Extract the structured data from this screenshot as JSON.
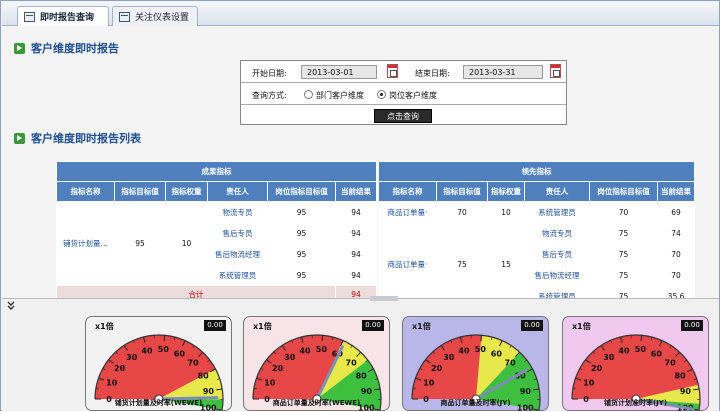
{
  "tabs": [
    {
      "label": "即时报告查询"
    },
    {
      "label": "关注仪表设置"
    }
  ],
  "section1": {
    "title": "客户维度即时报告"
  },
  "query": {
    "start_label": "开始日期:",
    "start_value": "2013-03-01",
    "end_label": "结束日期:",
    "end_value": "2013-03-31",
    "mode_label": "查询方式:",
    "options": [
      {
        "label": "部门客户维度",
        "selected": false
      },
      {
        "label": "岗位客户维度",
        "selected": true
      }
    ],
    "submit_label": "点击查询"
  },
  "section2": {
    "title": "客户维度即时报告列表"
  },
  "results": {
    "group_left": "成果指标",
    "group_right": "领先指标",
    "headers": [
      "指标名称",
      "指标目标值",
      "指标权重",
      "责任人",
      "岗位指标目标值",
      "当前结果"
    ],
    "left": {
      "name": "铺货计划量…",
      "target": "95",
      "weight": "10",
      "rows": [
        {
          "person": "物流专员",
          "target": "95",
          "result": "94"
        },
        {
          "person": "售后专员",
          "target": "95",
          "result": "94"
        },
        {
          "person": "售后物流经理",
          "target": "95",
          "result": "94"
        },
        {
          "person": "系统管理员",
          "target": "95",
          "result": "94"
        }
      ],
      "sum_label": "合计",
      "sum_value": "94"
    },
    "right": [
      {
        "name": "商品订单量·",
        "target": "70",
        "weight": "10",
        "rows": [
          {
            "person": "系统管理员",
            "target": "70",
            "result": "69"
          }
        ]
      },
      {
        "name": "商品订单量·",
        "target": "75",
        "weight": "15",
        "rows": [
          {
            "person": "物流专员",
            "target": "75",
            "result": "74"
          },
          {
            "person": "售后专员",
            "target": "75",
            "result": "70"
          },
          {
            "person": "售后物流经理",
            "target": "75",
            "result": "70"
          },
          {
            "person": "系统管理员",
            "target": "75",
            "result": "35.6"
          }
        ]
      }
    ]
  },
  "collapse_icon": "double-chevron-down-icon",
  "gauges": [
    {
      "multiplier": "x1倍",
      "readout": "0.00",
      "title": "铺货计划量及时率(WEWE)",
      "value": 94,
      "bg": "#f2f2f2",
      "ticks": [
        "0",
        "10",
        "20",
        "30",
        "40",
        "50",
        "60",
        "70",
        "80",
        "90",
        "100"
      ]
    },
    {
      "multiplier": "x1倍",
      "readout": "0.00",
      "title": "商品订单量及时率(WEWE)",
      "value": 61,
      "bg": "#f6e4e6",
      "ticks": [
        "0",
        "10",
        "20",
        "30",
        "40",
        "50",
        "60",
        "70",
        "80",
        "90",
        "100"
      ]
    },
    {
      "multiplier": "x1倍",
      "readout": "0.00",
      "title": "商品订单量及时率(JY)",
      "value": 79,
      "bg": "#b9b6ea",
      "ticks": [
        "0",
        "10",
        "20",
        "30",
        "40",
        "50",
        "60",
        "70",
        "80",
        "90",
        "100"
      ]
    },
    {
      "multiplier": "x1倍",
      "readout": "0.00",
      "title": "铺货计划准时率(JY)",
      "value": 100,
      "bg": "#f0c8f0",
      "ticks": [
        "0",
        "10",
        "20",
        "30",
        "40",
        "50",
        "60",
        "70",
        "80",
        "90",
        "100"
      ]
    }
  ],
  "gauge_zones": [
    [
      {
        "from": 0,
        "to": 80,
        "color": "#e84747"
      },
      {
        "from": 80,
        "to": 95,
        "color": "#e8e84a"
      },
      {
        "from": 95,
        "to": 100,
        "color": "#3fbf3f"
      }
    ],
    [
      {
        "from": 0,
        "to": 60,
        "color": "#e84747"
      },
      {
        "from": 60,
        "to": 75,
        "color": "#e8e84a"
      },
      {
        "from": 75,
        "to": 100,
        "color": "#3fbf3f"
      }
    ],
    [
      {
        "from": 0,
        "to": 50,
        "color": "#e84747"
      },
      {
        "from": 50,
        "to": 70,
        "color": "#e8e84a"
      },
      {
        "from": 70,
        "to": 100,
        "color": "#3fbf3f"
      }
    ],
    [
      {
        "from": 0,
        "to": 88,
        "color": "#e84747"
      },
      {
        "from": 88,
        "to": 97,
        "color": "#e8e84a"
      },
      {
        "from": 97,
        "to": 100,
        "color": "#3fbf3f"
      }
    ]
  ]
}
